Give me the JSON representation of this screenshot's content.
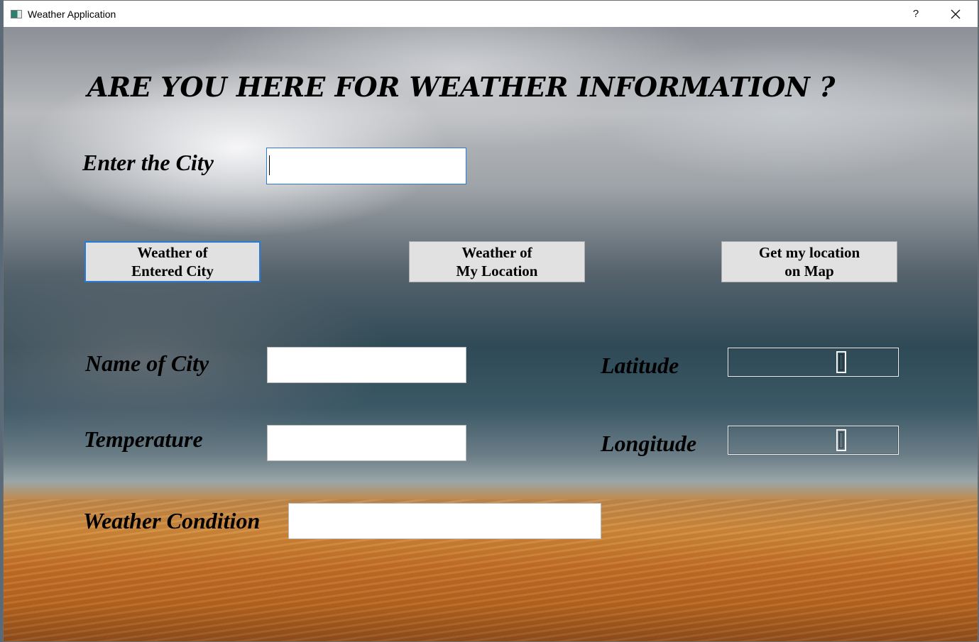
{
  "window": {
    "title": "Weather Application",
    "help_label": "?",
    "close_label": "✕"
  },
  "main": {
    "heading": "ARE YOU HERE FOR WEATHER INFORMATION ?",
    "city_label": "Enter the City",
    "city_input_value": "",
    "buttons": {
      "entered_city": "Weather of\nEntered City",
      "my_location": "Weather of\nMy Location",
      "map": "Get my location\non Map"
    },
    "name_label": "Name of City",
    "name_value": "",
    "temperature_label": "Temperature",
    "temperature_value": "",
    "condition_label": "Weather Condition",
    "condition_value": "",
    "latitude_label": "Latitude",
    "longitude_label": "Longitude"
  },
  "icons": {
    "app": "app-window-icon",
    "help": "help-icon",
    "close": "close-icon"
  },
  "colors": {
    "focus_border": "#2a7bd3",
    "button_face": "#e1e1e1"
  }
}
